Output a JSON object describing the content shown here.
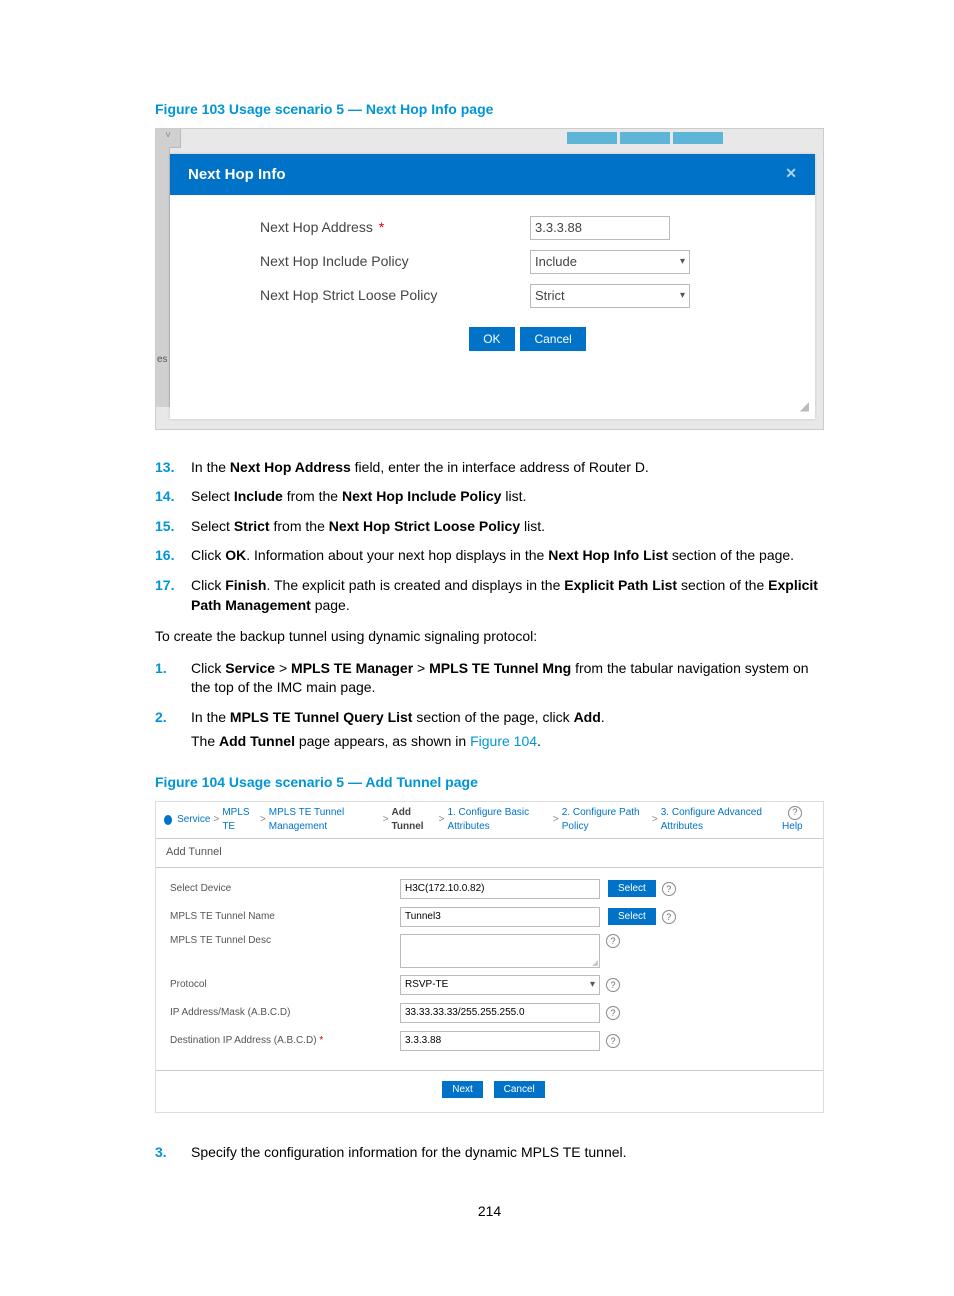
{
  "figure103": {
    "caption": "Figure 103 Usage scenario 5 — Next Hop Info page",
    "side_label": "es",
    "dialog": {
      "title": "Next Hop Info",
      "close": "✕",
      "fields": {
        "addr_label": "Next Hop Address",
        "addr_value": "3.3.3.88",
        "inc_label": "Next Hop Include Policy",
        "inc_value": "Include",
        "sl_label": "Next Hop Strict Loose Policy",
        "sl_value": "Strict"
      },
      "ok": "OK",
      "cancel": "Cancel"
    }
  },
  "steps_a": {
    "s13": {
      "n": "13.",
      "prefix": "In the ",
      "b1": "Next Hop Address",
      "rest": " field, enter the in interface address of Router D."
    },
    "s14": {
      "n": "14.",
      "prefix": "Select ",
      "b1": "Include",
      "mid": " from the ",
      "b2": "Next Hop Include Policy",
      "rest": " list."
    },
    "s15": {
      "n": "15.",
      "prefix": "Select ",
      "b1": "Strict",
      "mid": " from the ",
      "b2": "Next Hop Strict Loose Policy",
      "rest": " list."
    },
    "s16": {
      "n": "16.",
      "prefix": "Click ",
      "b1": "OK",
      "mid": ". Information about your next hop displays in the ",
      "b2": "Next Hop Info List",
      "rest": " section of the page."
    },
    "s17": {
      "n": "17.",
      "prefix": "Click ",
      "b1": "Finish",
      "mid": ". The explicit path is created and displays in the ",
      "b2": "Explicit Path List",
      "mid2": " section of the ",
      "b3": "Explicit Path Management",
      "rest": " page."
    }
  },
  "lead": "To create the backup tunnel using dynamic signaling protocol:",
  "steps_b": {
    "s1": {
      "n": "1.",
      "prefix": "Click ",
      "b1": "Service",
      "sep1": " > ",
      "b2": "MPLS TE Manager",
      "sep2": " > ",
      "b3": "MPLS TE Tunnel Mng",
      "rest": " from the tabular navigation system on the top of the IMC main page."
    },
    "s2": {
      "n": "2.",
      "prefix": "In the ",
      "b1": "MPLS TE Tunnel Query List",
      "mid": " section of the page, click ",
      "b2": "Add",
      "rest": ".",
      "sub_prefix": "The ",
      "sub_b": "Add Tunnel",
      "sub_mid": " page appears, as shown in ",
      "sub_link": "Figure 104",
      "sub_end": "."
    },
    "s3": {
      "n": "3.",
      "text": "Specify the configuration information for the dynamic MPLS TE tunnel."
    }
  },
  "figure104": {
    "caption": "Figure 104 Usage scenario 5 — Add Tunnel page",
    "breadcrumb": {
      "service": "Service",
      "mplste": "MPLS TE",
      "mgmt": "MPLS TE Tunnel Management",
      "add": "Add Tunnel",
      "step1": "1. Configure Basic Attributes",
      "step2": "2. Configure Path Policy",
      "step3": "3. Configure Advanced Attributes",
      "help": "Help"
    },
    "panel_title": "Add Tunnel",
    "fields": {
      "device_label": "Select Device",
      "device_value": "H3C(172.10.0.82)",
      "name_label": "MPLS TE Tunnel Name",
      "name_value": "Tunnel3",
      "desc_label": "MPLS TE Tunnel Desc",
      "desc_value": "",
      "proto_label": "Protocol",
      "proto_value": "RSVP-TE",
      "ipmask_label": "IP Address/Mask (A.B.C.D)",
      "ipmask_value": "33.33.33.33/255.255.255.0",
      "dest_label": "Destination IP Address (A.B.C.D)",
      "dest_value": "3.3.3.88"
    },
    "buttons": {
      "select": "Select",
      "next": "Next",
      "cancel": "Cancel"
    },
    "help_glyph": "?",
    "req": "*"
  },
  "page_number": "214",
  "caret": "▾"
}
